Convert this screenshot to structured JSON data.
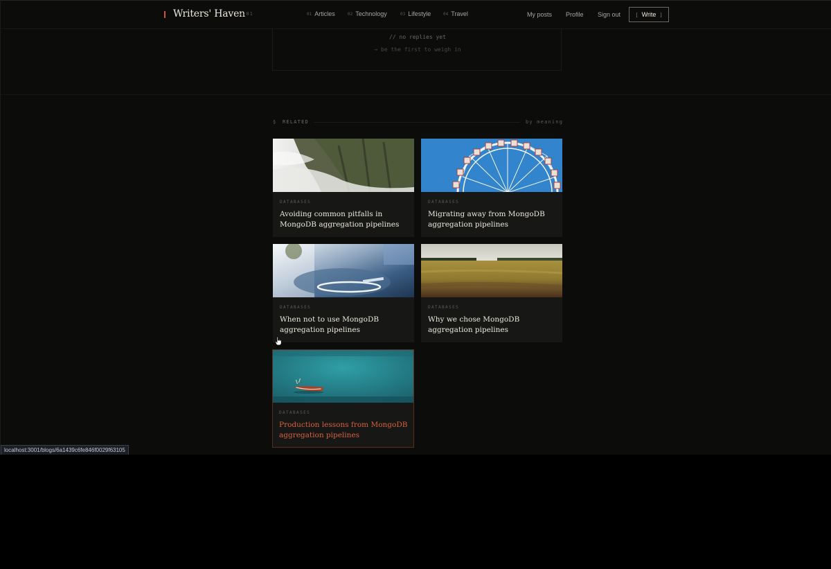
{
  "header": {
    "brand": "Writers' Haven",
    "version": "v.01",
    "nav": [
      {
        "num": "01",
        "label": "Articles"
      },
      {
        "num": "02",
        "label": "Technology"
      },
      {
        "num": "03",
        "label": "Lifestyle"
      },
      {
        "num": "04",
        "label": "Travel"
      }
    ],
    "my_posts": "My posts",
    "profile": "Profile",
    "sign_out": "Sign out",
    "write_label": "Write",
    "write_bracket_open": "[",
    "write_bracket_close": "]"
  },
  "replies": {
    "empty": "// no replies yet",
    "prompt": "→ be the first to weigh in"
  },
  "related": {
    "symbol": "§",
    "title": "RELATED",
    "by": "by meaning",
    "cards": [
      {
        "category": "DATABASES",
        "title": "Avoiding common pitfalls in MongoDB aggregation pipelines",
        "image": "cliff-and-mist"
      },
      {
        "category": "DATABASES",
        "title": "Migrating away from MongoDB aggregation pipelines",
        "image": "ferris-wheel"
      },
      {
        "category": "DATABASES",
        "title": "When not to use MongoDB aggregation pipelines",
        "image": "blurred-pan"
      },
      {
        "category": "DATABASES",
        "title": "Why we chose MongoDB aggregation pipelines",
        "image": "wheat-field"
      },
      {
        "category": "DATABASES",
        "title": "Production lessons from MongoDB aggregation pipelines",
        "image": "boat-on-water"
      }
    ]
  },
  "status_url": "localhost:3001/blogs/6a1439c6fe846f0029f63105",
  "colors": {
    "accent": "#d4552e",
    "background": "#0c0c0b",
    "card": "#171716"
  }
}
